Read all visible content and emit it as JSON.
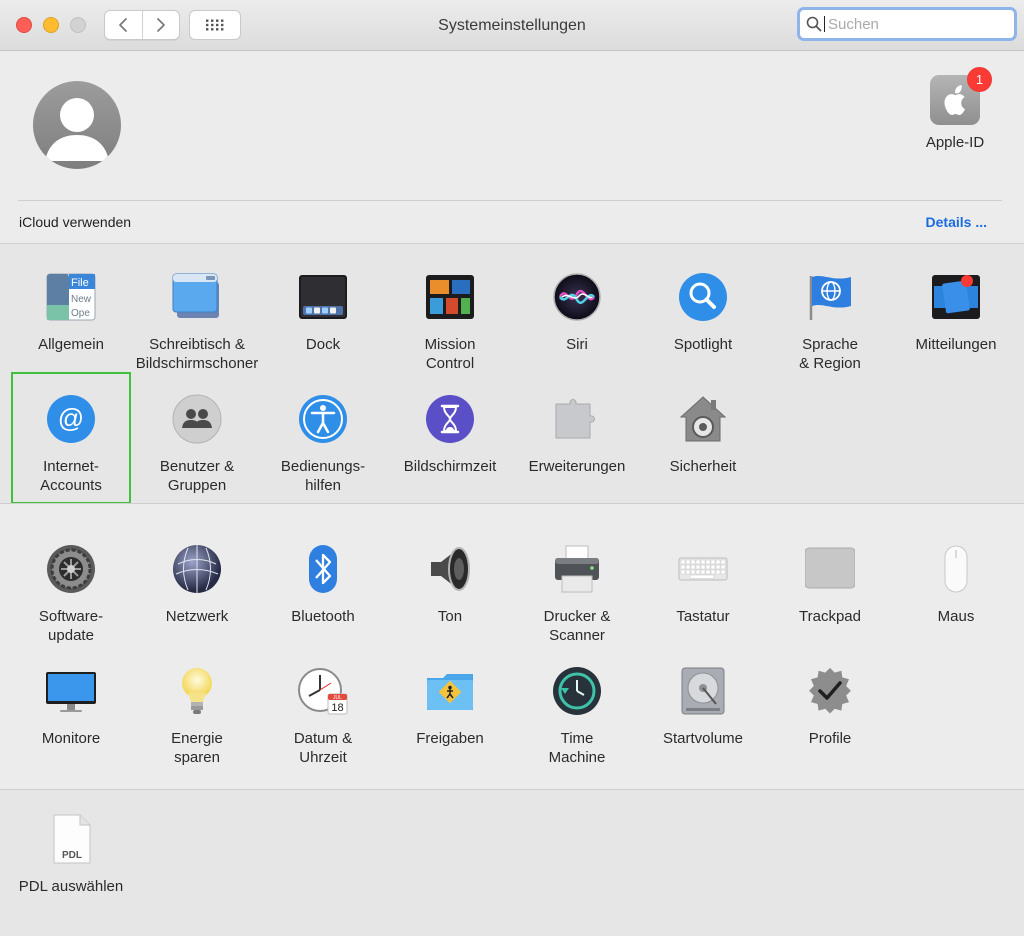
{
  "window": {
    "title": "Systemeinstellungen",
    "search_placeholder": "Suchen"
  },
  "account": {
    "apple_id_label": "Apple-ID",
    "apple_id_badge": "1",
    "icloud_label": "iCloud verwenden",
    "details_label": "Details ..."
  },
  "colors": {
    "accent": "#1b6be0",
    "badge": "#fb3a35",
    "highlight": "#3fc13c"
  },
  "sections": [
    {
      "rows": [
        [
          {
            "label": "Allgemein",
            "icon": "general-icon"
          },
          {
            "label": "Schreibtisch &\nBildschirmschoner",
            "icon": "desktop-screensaver-icon"
          },
          {
            "label": "Dock",
            "icon": "dock-icon"
          },
          {
            "label": "Mission\nControl",
            "icon": "mission-control-icon"
          },
          {
            "label": "Siri",
            "icon": "siri-icon"
          },
          {
            "label": "Spotlight",
            "icon": "spotlight-icon"
          },
          {
            "label": "Sprache\n& Region",
            "icon": "language-region-icon"
          },
          {
            "label": "Mitteilungen",
            "icon": "notifications-icon"
          }
        ],
        [
          {
            "label": "Internet-\nAccounts",
            "icon": "internet-accounts-icon",
            "highlighted": true
          },
          {
            "label": "Benutzer &\nGruppen",
            "icon": "users-groups-icon"
          },
          {
            "label": "Bedienungs-\nhilfen",
            "icon": "accessibility-icon"
          },
          {
            "label": "Bildschirmzeit",
            "icon": "screen-time-icon"
          },
          {
            "label": "Erweiterungen",
            "icon": "extensions-icon"
          },
          {
            "label": "Sicherheit",
            "icon": "security-icon"
          }
        ]
      ]
    },
    {
      "rows": [
        [
          {
            "label": "Software-\nupdate",
            "icon": "software-update-icon"
          },
          {
            "label": "Netzwerk",
            "icon": "network-icon"
          },
          {
            "label": "Bluetooth",
            "icon": "bluetooth-icon"
          },
          {
            "label": "Ton",
            "icon": "sound-icon"
          },
          {
            "label": "Drucker &\nScanner",
            "icon": "printer-scanner-icon"
          },
          {
            "label": "Tastatur",
            "icon": "keyboard-icon"
          },
          {
            "label": "Trackpad",
            "icon": "trackpad-icon"
          },
          {
            "label": "Maus",
            "icon": "mouse-icon"
          }
        ],
        [
          {
            "label": "Monitore",
            "icon": "displays-icon"
          },
          {
            "label": "Energie\nsparen",
            "icon": "energy-saver-icon"
          },
          {
            "label": "Datum &\nUhrzeit",
            "icon": "date-time-icon",
            "calendar_month": "JUL",
            "calendar_day": "18"
          },
          {
            "label": "Freigaben",
            "icon": "sharing-icon"
          },
          {
            "label": "Time\nMachine",
            "icon": "time-machine-icon"
          },
          {
            "label": "Startvolume",
            "icon": "startup-disk-icon"
          },
          {
            "label": "Profile",
            "icon": "profiles-icon"
          }
        ]
      ]
    },
    {
      "rows": [
        [
          {
            "label": "PDL auswählen",
            "icon": "pdl-icon",
            "icon_text": "PDL"
          }
        ]
      ]
    }
  ]
}
